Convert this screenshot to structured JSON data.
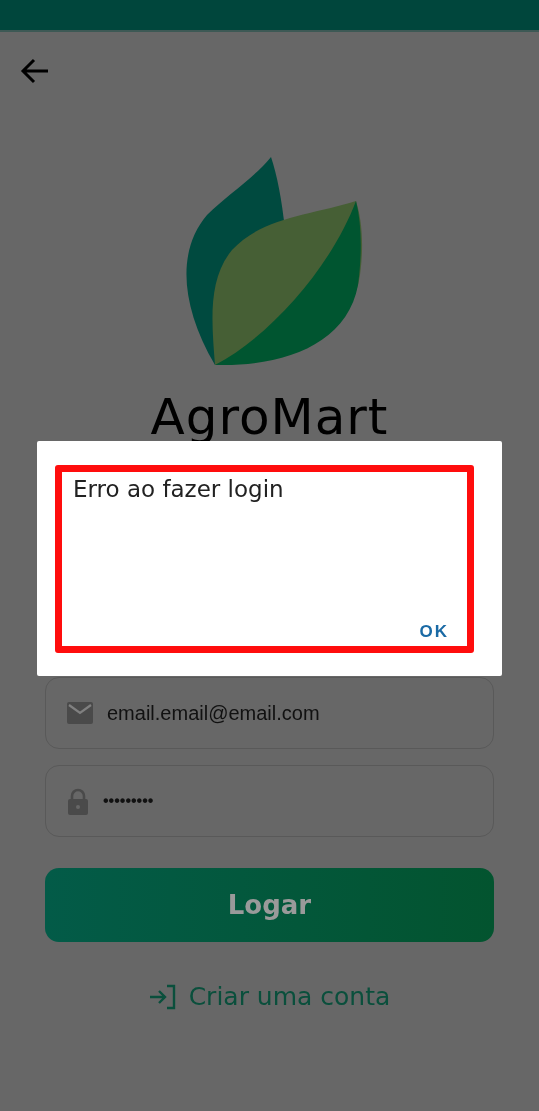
{
  "app": {
    "title": "AgroMart"
  },
  "form": {
    "email": {
      "value": "email.email@email.com"
    },
    "password": {
      "value": "•••••••••"
    },
    "submit": "Logar",
    "signup_link": "Criar uma conta"
  },
  "dialog": {
    "message": "Erro ao fazer login",
    "button": "OK",
    "highlighted": true
  }
}
